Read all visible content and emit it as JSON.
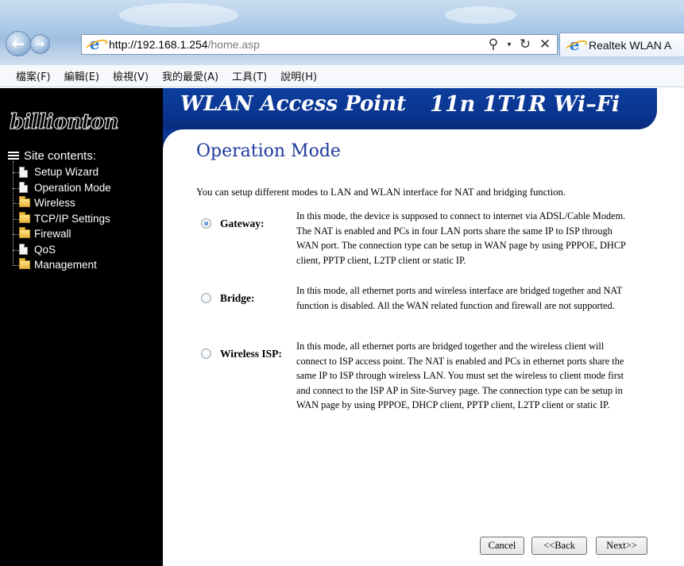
{
  "browser": {
    "url_host": "http://192.168.1.254",
    "url_path": "/home.asp",
    "tab_title": "Realtek WLAN A",
    "address_tools": [
      "search-icon",
      "dropdown-icon",
      "refresh-icon",
      "stop-icon"
    ]
  },
  "menubar": {
    "items": [
      "檔案(F)",
      "編輯(E)",
      "檢視(V)",
      "我的最愛(A)",
      "工具(T)",
      "說明(H)"
    ]
  },
  "sidebar": {
    "logo": "billionton",
    "root_label": "Site contents:",
    "items": [
      {
        "label": "Setup Wizard",
        "icon": "document-icon"
      },
      {
        "label": "Operation Mode",
        "icon": "document-icon"
      },
      {
        "label": "Wireless",
        "icon": "folder-icon"
      },
      {
        "label": "TCP/IP Settings",
        "icon": "folder-icon"
      },
      {
        "label": "Firewall",
        "icon": "folder-icon"
      },
      {
        "label": "QoS",
        "icon": "document-icon"
      },
      {
        "label": "Management",
        "icon": "folder-icon"
      }
    ]
  },
  "banner": {
    "left": "WLAN Access Point",
    "right": "11n  1T1R Wi–Fi"
  },
  "main": {
    "title": "Operation Mode",
    "intro": "You can setup different modes to LAN and WLAN interface for NAT and bridging function.",
    "modes": [
      {
        "label": "Gateway:",
        "checked": true,
        "description": "In this mode, the device is supposed to connect to internet via ADSL/Cable Modem. The NAT is enabled and PCs in four LAN ports share the same IP to ISP through WAN port. The connection type can be setup in WAN page by using PPPOE, DHCP client, PPTP client, L2TP client or static IP."
      },
      {
        "label": "Bridge:",
        "checked": false,
        "description": "In this mode, all ethernet ports and wireless interface are bridged together and NAT function is disabled. All the WAN related function and firewall are not supported."
      },
      {
        "label": "Wireless ISP:",
        "checked": false,
        "description": "In this mode, all ethernet ports are bridged together and the wireless client will connect to ISP access point. The NAT is enabled and PCs in ethernet ports share the same IP to ISP through wireless LAN. You must set the wireless to client mode first and connect to the ISP AP in Site-Survey page. The connection type can be setup in WAN page by using PPPOE, DHCP client, PPTP client, L2TP client or static IP."
      }
    ],
    "buttons": {
      "cancel": "Cancel",
      "back": "<<Back",
      "next": "Next>>"
    }
  },
  "colors": {
    "banner_blue": "#0a3590",
    "title_blue": "#1f3a9a",
    "sidebar_bg": "#000000"
  }
}
